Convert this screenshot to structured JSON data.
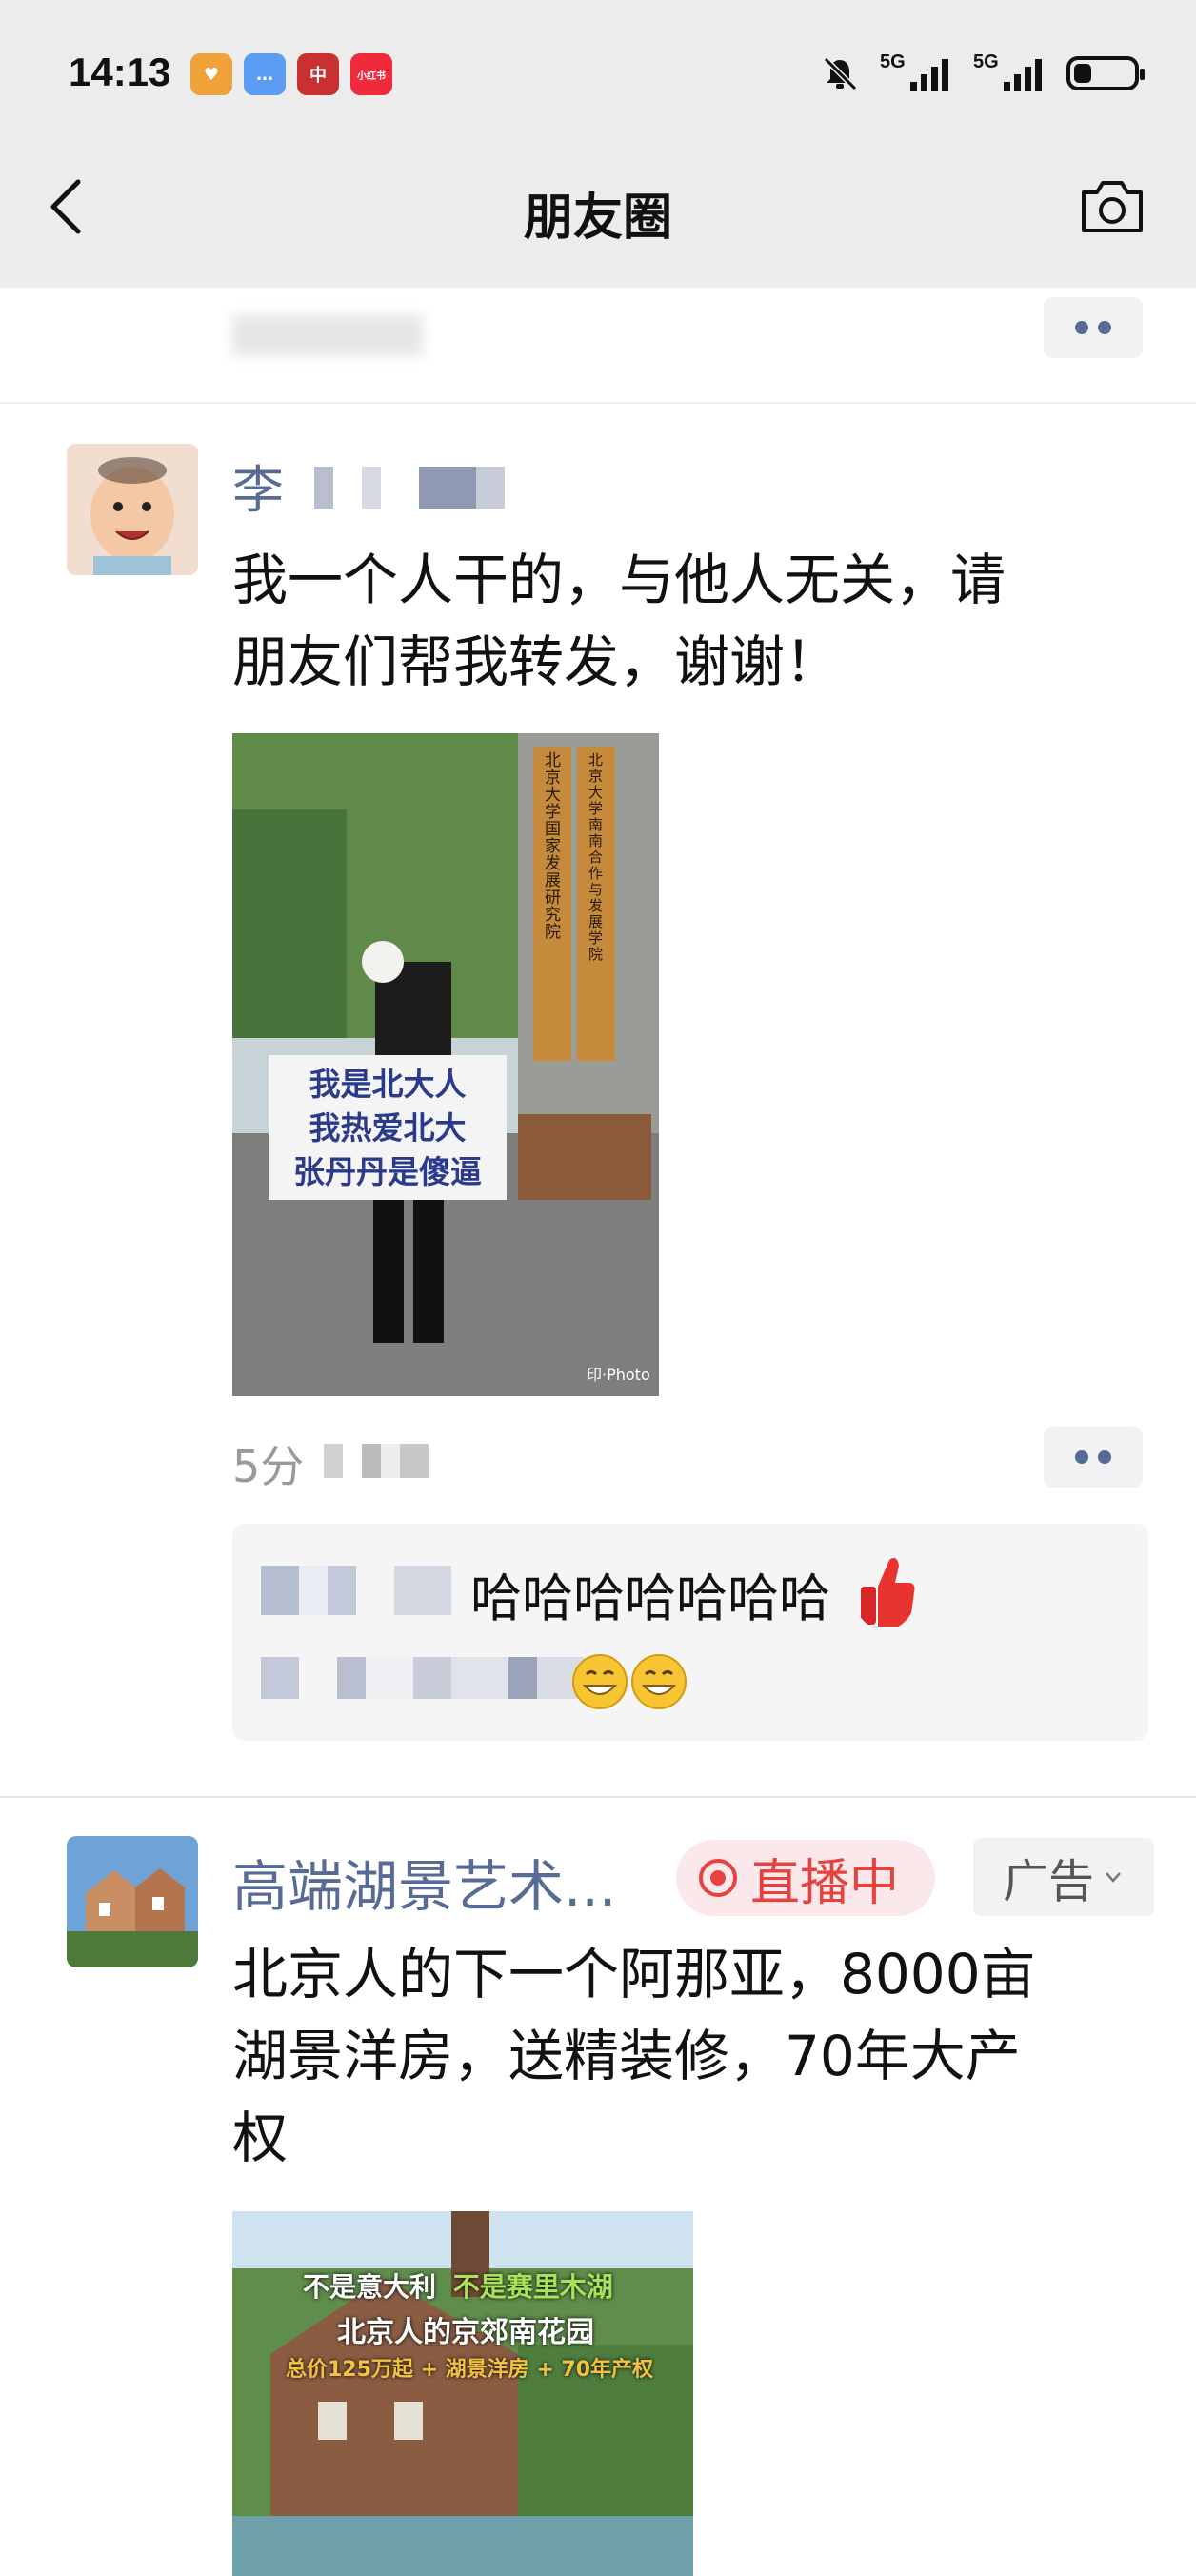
{
  "status_bar": {
    "time": "14:13",
    "app_icons": [
      {
        "name": "heart-app-icon",
        "color": "#f0a23a",
        "glyph": "♥"
      },
      {
        "name": "chat-app-icon",
        "color": "#5b9cf2",
        "glyph": "…"
      },
      {
        "name": "bank-app-icon",
        "color": "#c8312f",
        "glyph": "中"
      },
      {
        "name": "xiaohongshu-app-icon",
        "color": "#ef2a3a",
        "glyph": "小红书"
      }
    ],
    "network_1": "5G",
    "network_2": "5G",
    "battery_level": 0.3
  },
  "nav": {
    "title": "朋友圈"
  },
  "post1": {
    "name_visible": "李",
    "text_line1": "我一个人干的，与他人无关，请",
    "text_line2": "朋友们帮我转发，谢谢！",
    "sign_lines": [
      "我是北大人",
      "我热爱北大",
      "张丹丹是傻逼"
    ],
    "plaque_left": "北京大学 国家发展研究院",
    "plaque_right": "北京大学 南南合作与发展学院",
    "photo_watermark": "印·Photo",
    "time": "5分",
    "comment_1": "哈哈哈哈哈哈哈"
  },
  "ad_post": {
    "name": "高端湖景艺术...",
    "live_label": "直播中",
    "ad_label": "广告",
    "text_line1": "北京人的下一个阿那亚，8000亩",
    "text_line2": "湖景洋房，送精装修，70年大产",
    "text_line3": "权",
    "image_line1a": "不是意大利",
    "image_line1b": "不是赛里木湖",
    "image_line2": "北京人的京郊南花园",
    "image_line3": "总价125万起 + 湖景洋房 + 70年产权"
  },
  "colors": {
    "link_blue": "#576b95",
    "live_red": "#e64340",
    "header_gray": "#ececec"
  }
}
